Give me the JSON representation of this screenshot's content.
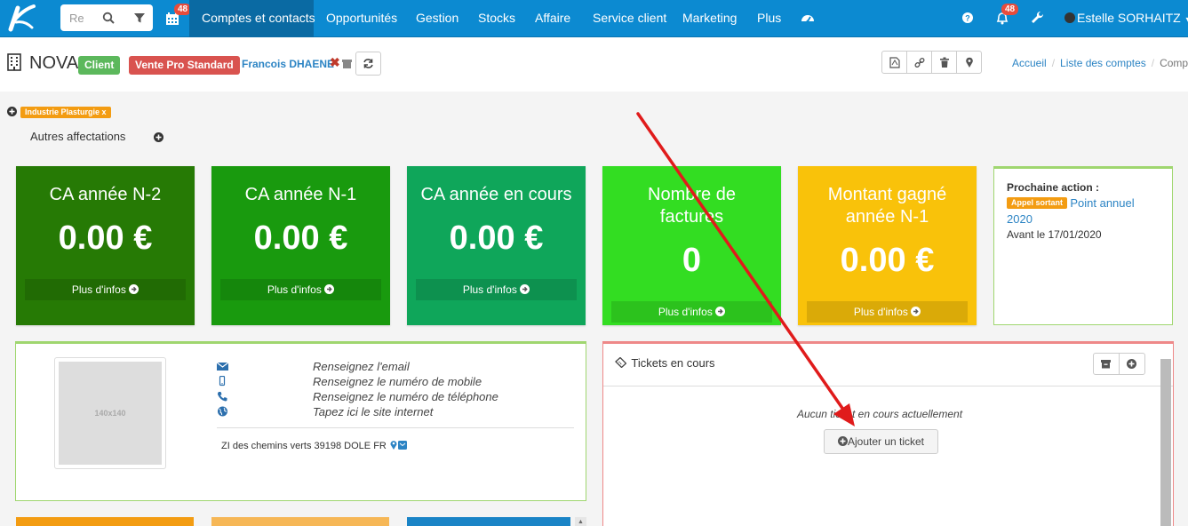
{
  "navbar": {
    "search_placeholder": "Re",
    "calendar_badge": "48",
    "items": [
      {
        "label": "Comptes et contacts",
        "active": true
      },
      {
        "label": "Opportunités",
        "active": false
      },
      {
        "label": "Gestion",
        "active": false
      },
      {
        "label": "Stocks",
        "active": false
      },
      {
        "label": "Affaire",
        "active": false
      },
      {
        "label": "Service client",
        "active": false
      },
      {
        "label": "Marketing",
        "active": false
      },
      {
        "label": "Plus",
        "active": false
      }
    ],
    "notif_badge": "48",
    "user_name": "Estelle SORHAITZ",
    "brand_color": "#0c8ad1"
  },
  "header": {
    "title": "NOVA",
    "labels": {
      "client": "Client",
      "vente": "Vente Pro Standard"
    },
    "owner": "Francois DHAENE",
    "remove_mark": "✖",
    "breadcrumb": {
      "home": "Accueil",
      "list": "Liste des comptes",
      "current": "Compte"
    }
  },
  "affectations": {
    "tag": "Industrie Plasturgie x",
    "label": "Autres affectations"
  },
  "stats": [
    {
      "title": "CA année N-2",
      "value": "0.00 €",
      "more": "Plus d'infos",
      "color": "#267a05"
    },
    {
      "title": "CA année N-1",
      "value": "0.00 €",
      "more": "Plus d'infos",
      "color": "#199a0e"
    },
    {
      "title": "CA année en cours",
      "value": "0.00 €",
      "more": "Plus d'infos",
      "color": "#0fa65a"
    },
    {
      "title": "Nombre de factures",
      "value": "0",
      "more": "Plus d'infos",
      "color": "#33dd22"
    },
    {
      "title": "Montant gagné année N-1",
      "value": "0.00 €",
      "more": "Plus d'infos",
      "color": "#f9c20a"
    }
  ],
  "next_action": {
    "title": "Prochaine action :",
    "tag": "Appel sortant",
    "link": "Point annuel 2020",
    "due": "Avant le 17/01/2020"
  },
  "contact": {
    "thumb_label": "140x140",
    "rows": [
      {
        "icon": "envelope-icon",
        "text": "Renseignez l'email"
      },
      {
        "icon": "mobile-icon",
        "text": "Renseignez le numéro de mobile"
      },
      {
        "icon": "phone-icon",
        "text": "Renseignez le numéro de téléphone"
      },
      {
        "icon": "globe-icon",
        "text": "Tapez ici le site internet"
      }
    ],
    "address": "ZI des chemins verts 39198 DOLE FR"
  },
  "tickets": {
    "title": "Tickets en cours",
    "empty": "Aucun ticket en cours actuellement",
    "add_label": "Ajouter un ticket"
  },
  "annotation": {
    "arrow_color": "#e01b1b"
  }
}
